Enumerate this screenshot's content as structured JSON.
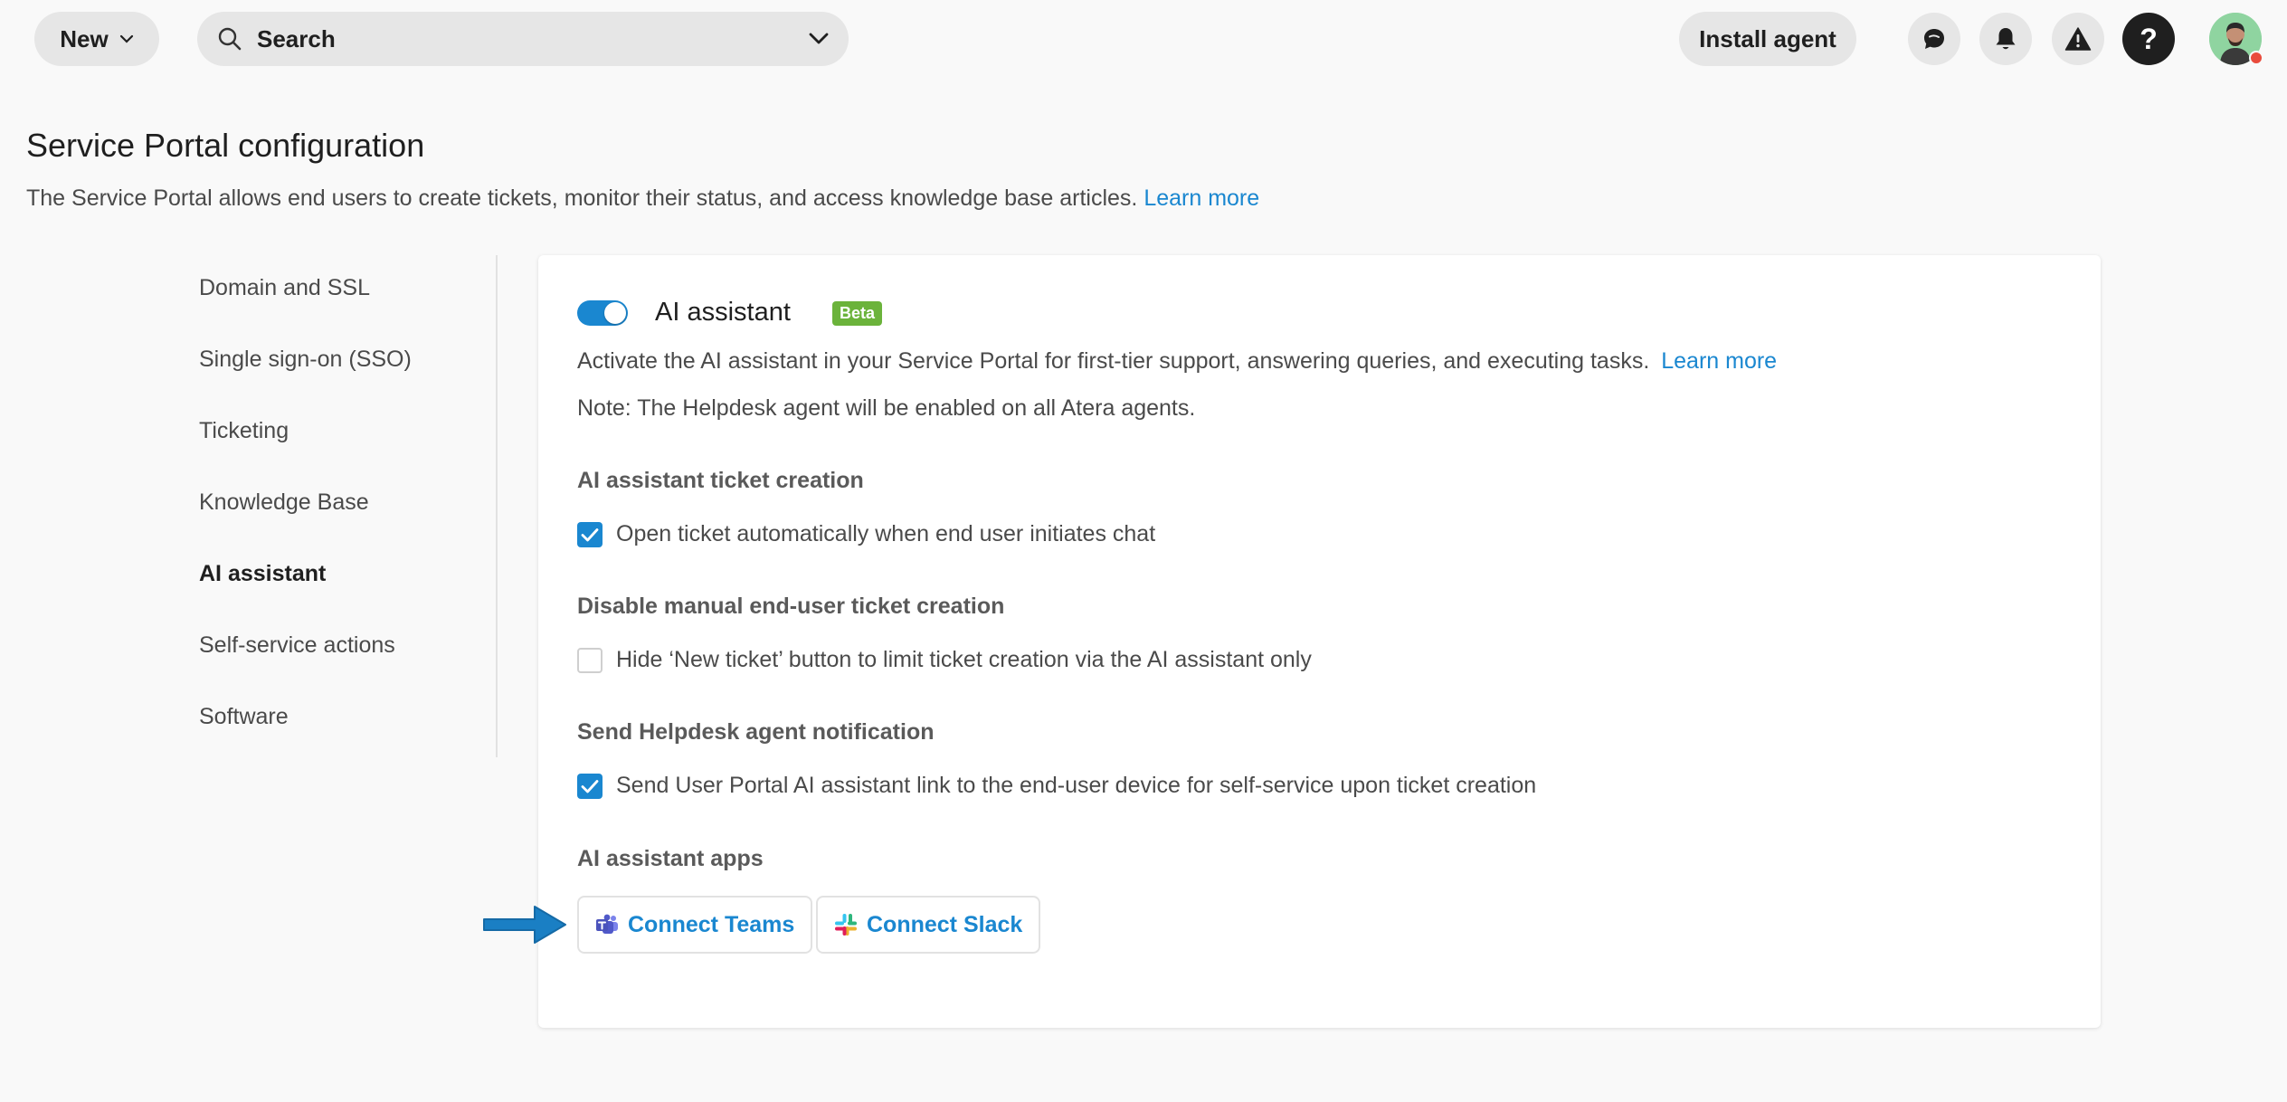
{
  "topbar": {
    "new_label": "New",
    "search_label": "Search",
    "install_label": "Install agent",
    "help_glyph": "?"
  },
  "header": {
    "title": "Service Portal configuration",
    "description": "The Service Portal allows end users to create tickets, monitor their status, and access knowledge base articles.",
    "learn_more": "Learn more"
  },
  "sidenav": {
    "items": [
      {
        "label": "Domain and SSL"
      },
      {
        "label": "Single sign-on (SSO)"
      },
      {
        "label": "Ticketing"
      },
      {
        "label": "Knowledge Base"
      },
      {
        "label": "AI assistant"
      },
      {
        "label": "Self-service actions"
      },
      {
        "label": "Software"
      }
    ],
    "active": "AI assistant"
  },
  "card": {
    "title": "AI assistant",
    "badge": "Beta",
    "enabled": true,
    "description": "Activate the AI assistant in your Service Portal for first-tier support, answering queries, and executing tasks.",
    "learn_more": "Learn more",
    "note": "Note: The Helpdesk agent will be enabled on all Atera agents.",
    "sections": [
      {
        "title": "AI assistant ticket creation",
        "option": "Open ticket automatically when end user initiates chat",
        "checked": true
      },
      {
        "title": "Disable manual end-user ticket creation",
        "option": "Hide ‘New ticket’ button to limit ticket creation via the AI assistant only",
        "checked": false
      },
      {
        "title": "Send Helpdesk agent notification",
        "option": "Send User Portal AI assistant link to the end-user device for self-service upon ticket creation",
        "checked": true
      }
    ],
    "apps_title": "AI assistant apps",
    "apps": [
      {
        "label": "Connect Teams",
        "icon": "teams-icon"
      },
      {
        "label": "Connect Slack",
        "icon": "slack-icon"
      }
    ]
  },
  "colors": {
    "accent": "#1a87d0",
    "beta": "#6bb33b",
    "background": "#f9f9f9"
  }
}
